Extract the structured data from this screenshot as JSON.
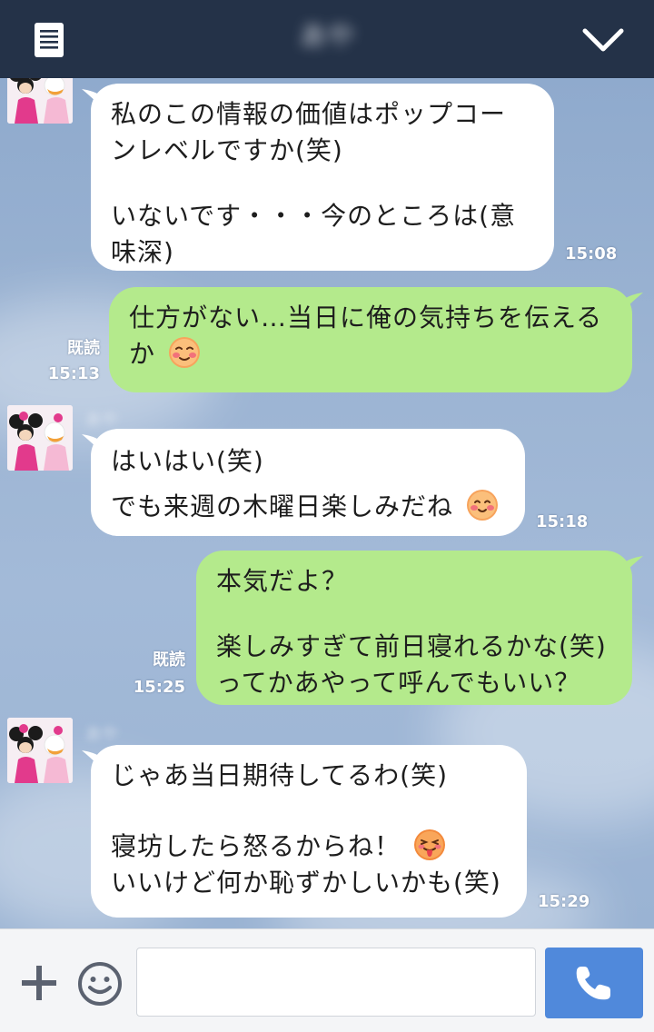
{
  "header": {
    "title": "あや"
  },
  "icons": {
    "menu": "document-list-icon",
    "collapse": "chevron-down-icon",
    "add": "plus-icon",
    "sticker": "smiley-icon",
    "call": "phone-icon"
  },
  "colors": {
    "header_bg": "#243248",
    "incoming_bubble": "#ffffff",
    "outgoing_bubble": "#b4ea8c",
    "call_button": "#5089db"
  },
  "messages": [
    {
      "direction": "in",
      "lines": [
        "私のこの情報の価値はポップコー",
        "ンレベルですか(笑)",
        "",
        "いないです・・・今のところは(意",
        "味深)"
      ],
      "time": "15:08"
    },
    {
      "direction": "out",
      "lines": [
        "仕方がない…当日に俺の気持ちを伝える",
        "か"
      ],
      "emoji": "blushing-face-emoji",
      "read": "既読",
      "time": "15:13"
    },
    {
      "direction": "in",
      "sender": "あや",
      "lines": [
        "はいはい(笑)",
        "でも来週の木曜日楽しみだね"
      ],
      "emoji": "smiling-face-emoji",
      "time": "15:18"
    },
    {
      "direction": "out",
      "lines": [
        "本気だよ？",
        "",
        "楽しみすぎて前日寝れるかな(笑)",
        "ってかあやって呼んでもいい？"
      ],
      "read": "既読",
      "time": "15:25"
    },
    {
      "direction": "in",
      "sender": "あや",
      "lines": [
        "じゃあ当日期待してるわ(笑)",
        "",
        "寝坊したら怒るからね！",
        "いいけど何か恥ずかしいかも(笑)"
      ],
      "emoji": "tongue-out-face-emoji",
      "time": "15:29"
    }
  ],
  "input": {
    "value": "",
    "placeholder": ""
  }
}
